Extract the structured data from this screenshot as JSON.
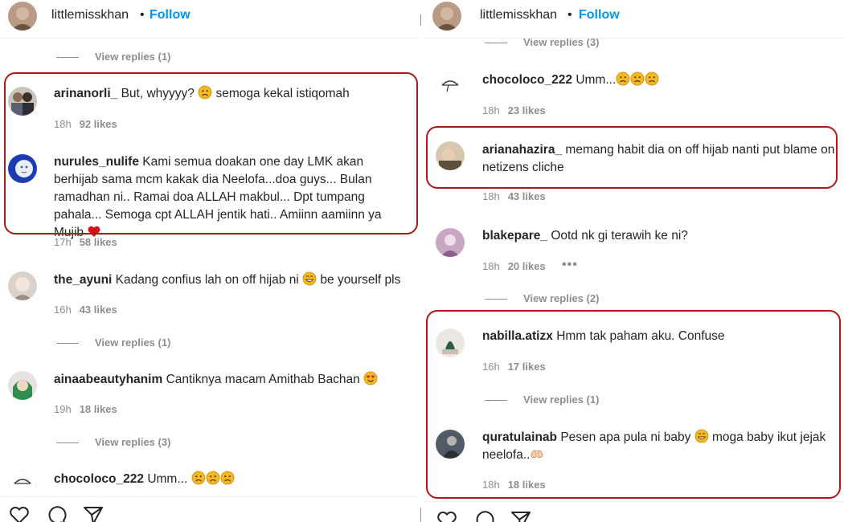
{
  "left": {
    "header": {
      "username": "littlemisskhan",
      "separator": "•",
      "follow": "Follow"
    },
    "top_replies": "View replies (1)",
    "comments": [
      {
        "username": "arinanorli_",
        "text": "But, whyyyy?",
        "text_after": "semoga kekal istiqomah",
        "emoji": "sad",
        "time": "18h",
        "likes": "92 likes"
      },
      {
        "username": "nurules_nulife",
        "text": "Kami semua doakan one day LMK akan berhijab sama mcm kakak dia Neelofa...doa guys... Bulan ramadhan ni.. Ramai doa ALLAH makbul... Dpt tumpang pahala... Semoga cpt ALLAH jentik hati.. Amiinn aamiinn ya Mujib",
        "emoji": "heart",
        "time": "17h",
        "likes": "58 likes"
      },
      {
        "username": "the_ayuni",
        "text": "Kadang confius lah on off hijab ni",
        "text_after": "be yourself pls",
        "emoji": "grin",
        "time": "16h",
        "likes": "43 likes",
        "replies": "View replies (1)"
      },
      {
        "username": "ainaabeautyhanim",
        "text": "Cantiknya macam Amithab Bachan",
        "emoji": "heart-eyes",
        "time": "19h",
        "likes": "18 likes",
        "replies": "View replies (3)"
      },
      {
        "username": "chocoloco_222",
        "text": "Umm...",
        "emoji": "sad-x3"
      }
    ]
  },
  "right": {
    "header": {
      "username": "littlemisskhan",
      "separator": "•",
      "follow": "Follow"
    },
    "top_replies": "View replies (3)",
    "comments": [
      {
        "username": "chocoloco_222",
        "text": "Umm...",
        "emoji": "sad-x3",
        "time": "18h",
        "likes": "23 likes"
      },
      {
        "username": "arianahazira_",
        "text": "memang habit dia on off hijab nanti put blame on netizens cliche",
        "time": "18h",
        "likes": "43 likes"
      },
      {
        "username": "blakepare_",
        "text": "Ootd nk gi terawih ke ni?",
        "time": "18h",
        "likes": "20 likes",
        "more": "•••",
        "replies": "View replies (2)"
      },
      {
        "username": "nabilla.atizx",
        "text": "Hmm tak paham aku. Confuse",
        "time": "16h",
        "likes": "17 likes",
        "replies": "View replies (1)"
      },
      {
        "username": "quratulainab",
        "text": "Pesen apa pula ni baby",
        "text_after": "moga baby ikut jejak neelofa..",
        "emoji": "grin",
        "time": "18h",
        "likes": "18 likes"
      }
    ]
  },
  "colors": {
    "highlight": "#b01717",
    "link": "#0095f6",
    "muted": "#8e8e8e",
    "text": "#262626"
  },
  "icons": [
    "heart-icon",
    "comment-icon",
    "share-icon"
  ]
}
